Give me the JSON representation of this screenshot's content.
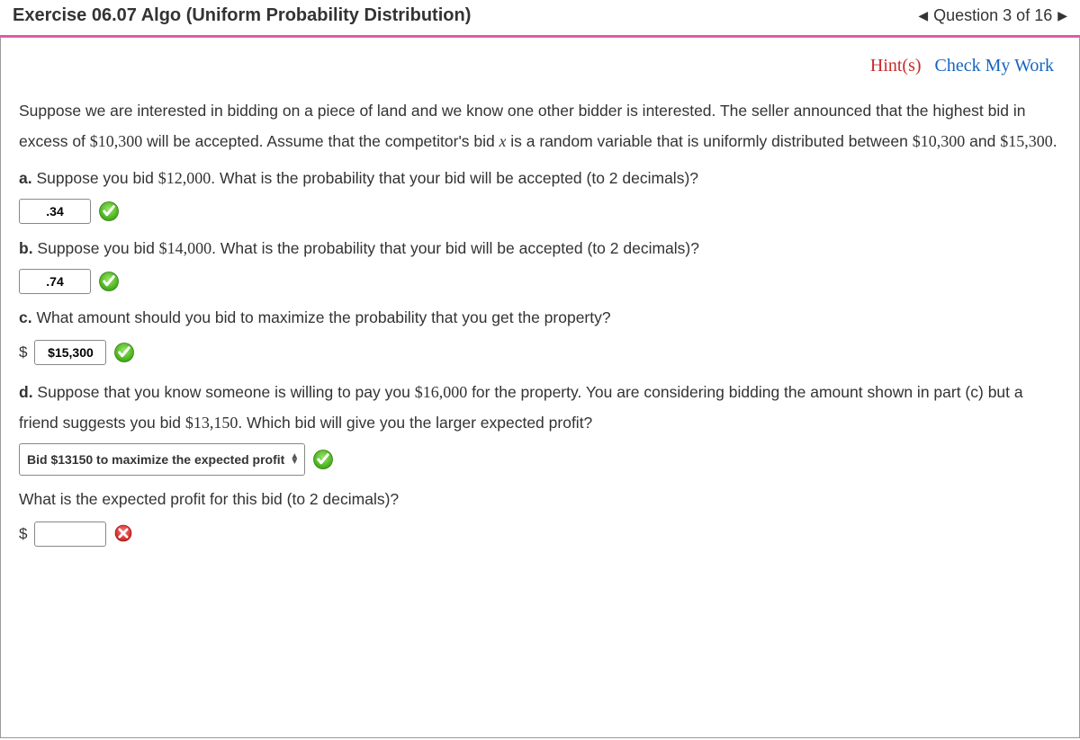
{
  "header": {
    "title": "Exercise 06.07 Algo (Uniform Probability Distribution)",
    "qnav": "Question 3 of 16"
  },
  "actions": {
    "hints": "Hint(s)",
    "check": "Check My Work"
  },
  "problem": {
    "intro_1": "Suppose we are interested in bidding on a piece of land and we know one other bidder is interested. The seller announced that the highest bid in excess of ",
    "intro_b1": "$10,300",
    "intro_2": " will be accepted. Assume that the competitor's bid ",
    "intro_var": "x",
    "intro_3": " is a random variable that is uniformly distributed between ",
    "intro_b2": "$10,300",
    "intro_4": " and ",
    "intro_b3": "$15,300",
    "intro_5": ".",
    "a_label": "a.",
    "a_1": " Suppose you bid ",
    "a_bid": "$12,000",
    "a_2": ". What is the probability that your bid will be accepted (to 2 decimals)?",
    "a_answer": ".34",
    "b_label": "b.",
    "b_1": " Suppose you bid ",
    "b_bid": "$14,000",
    "b_2": ". What is the probability that your bid will be accepted (to 2 decimals)?",
    "b_answer": ".74",
    "c_label": "c.",
    "c_text": " What amount should you bid to maximize the probability that you get the property?",
    "c_prefix": "$",
    "c_answer": "$15,300",
    "d_label": "d.",
    "d_1": " Suppose that you know someone is willing to pay you ",
    "d_pay": "$16,000",
    "d_2": " for the property. You are considering bidding the amount shown in part (c) but a friend suggests you bid ",
    "d_bid": "$13,150",
    "d_3": ". Which bid will give you the larger expected profit?",
    "d_select": "Bid $13150 to maximize the expected profit",
    "d_followup": "What is the expected profit for this bid (to 2 decimals)?",
    "d_prefix": "$",
    "d_answer": ""
  }
}
